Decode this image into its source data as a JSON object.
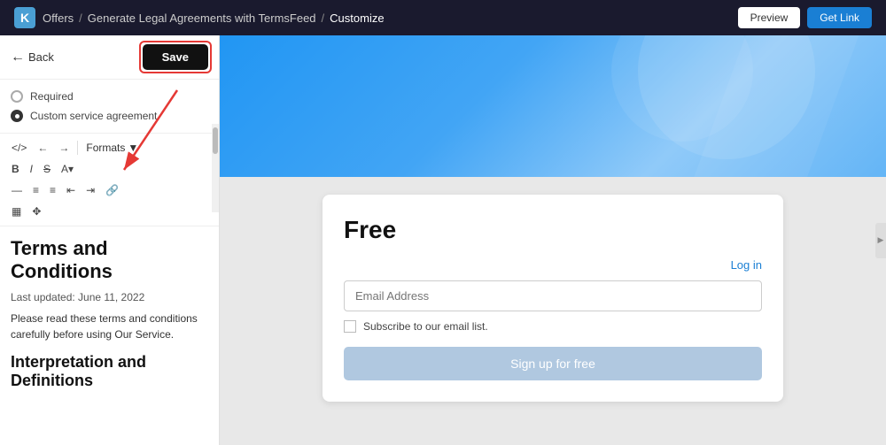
{
  "nav": {
    "logo": "K",
    "breadcrumbs": [
      {
        "label": "Offers",
        "href": "#"
      },
      {
        "label": "Generate Legal Agreements with TermsFeed",
        "href": "#"
      },
      {
        "label": "Customize",
        "current": true
      }
    ],
    "preview_label": "Preview",
    "get_link_label": "Get Link"
  },
  "left_panel": {
    "back_label": "Back",
    "save_label": "Save",
    "options": [
      {
        "id": "required",
        "label": "Required",
        "selected": false
      },
      {
        "id": "custom",
        "label": "Custom service agreement",
        "selected": true
      }
    ],
    "toolbar": {
      "formats_label": "Formats",
      "tools_row1": [
        "</>",
        "←",
        "→"
      ],
      "tools_row2": [
        "B",
        "I",
        "S",
        "A"
      ],
      "tools_row3": [
        "—",
        "≡",
        "≡",
        "≡",
        "≡",
        "🔗"
      ],
      "tools_row4": [
        "📊",
        "⛶"
      ]
    },
    "doc": {
      "title": "Terms and Conditions",
      "updated": "Last updated: June 11, 2022",
      "body": "Please read these terms and conditions carefully before using Our Service.",
      "section_title": "Interpretation and Definitions"
    }
  },
  "right_panel": {
    "plan_title": "Free",
    "login_label": "Log in",
    "email_placeholder": "Email Address",
    "subscribe_label": "Subscribe to our email list.",
    "signup_label": "Sign up for free"
  }
}
